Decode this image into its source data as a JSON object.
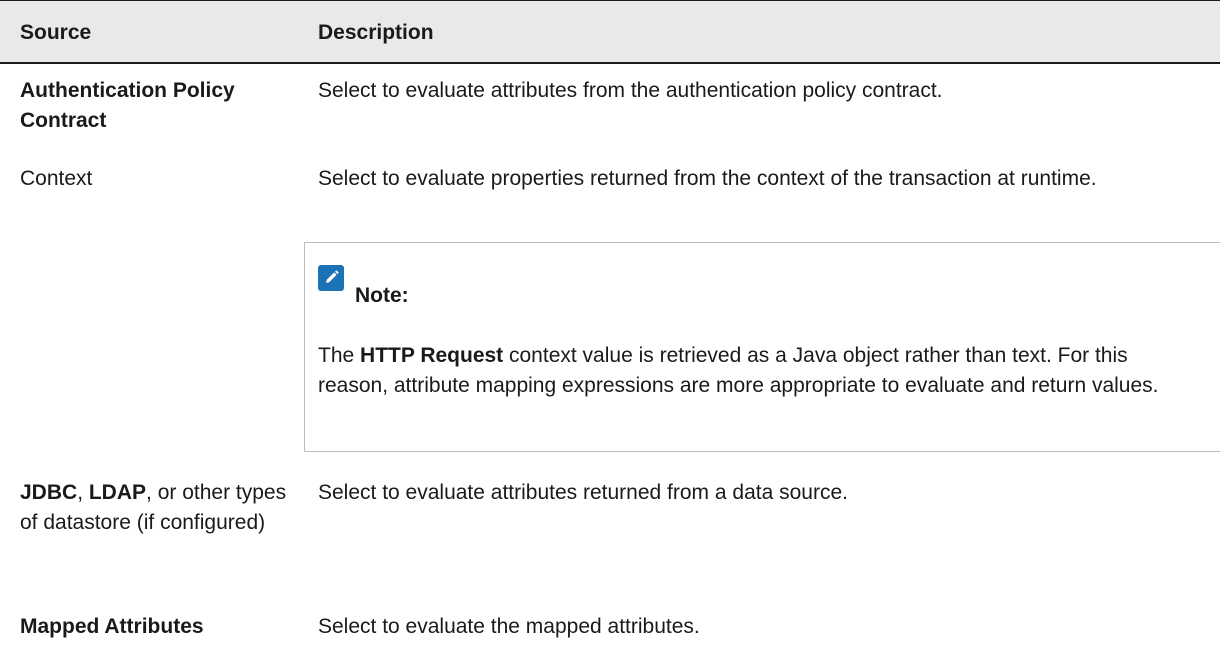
{
  "table": {
    "headers": {
      "source": "Source",
      "description": "Description"
    },
    "rows": [
      {
        "source": "Authentication Policy Contract",
        "description": "Select to evaluate attributes from the authentication policy contract."
      },
      {
        "source": "Context",
        "description": "Select to evaluate properties returned from the context of the transaction at runtime.",
        "note": {
          "title": "Note:",
          "icon": "pencil-note-icon",
          "text_pre": "The ",
          "text_bold": "HTTP Request",
          "text_post": " context value is retrieved as a Java object rather than text. For this reason, attribute mapping expressions are more appropriate to evaluate and return values."
        }
      },
      {
        "source_bold_1": "JDBC",
        "source_sep_1": ", ",
        "source_bold_2": "LDAP",
        "source_rest": ", or other types of datastore (if configured)",
        "description": "Select to evaluate attributes returned from a data source."
      },
      {
        "source": "Mapped Attributes",
        "description": "Select to evaluate the mapped attributes."
      }
    ]
  },
  "colors": {
    "header_bg": "#e9e9e9",
    "icon_bg": "#1b72b4",
    "text": "#1a1a1a"
  }
}
